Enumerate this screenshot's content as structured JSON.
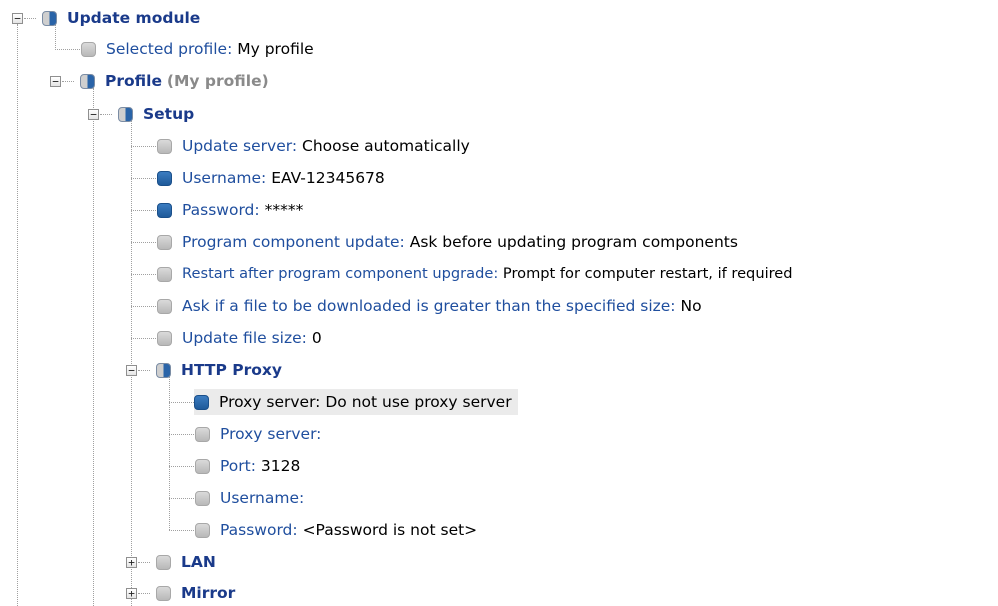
{
  "tree": {
    "update_module": {
      "label": "Update module"
    },
    "selected_profile": {
      "label": "Selected profile:",
      "value": "My profile"
    },
    "profile": {
      "label": "Profile",
      "value": "(My profile)"
    },
    "setup": {
      "label": "Setup"
    },
    "update_server": {
      "label": "Update server:",
      "value": "Choose automatically"
    },
    "username": {
      "label": "Username:",
      "value": "EAV-12345678"
    },
    "password": {
      "label": "Password:",
      "value": "*****"
    },
    "program_component_update": {
      "label": "Program component update:",
      "value": "Ask before updating program components"
    },
    "restart_after_upgrade": {
      "label": "Restart after program component upgrade:",
      "value": "Prompt for computer restart, if required"
    },
    "ask_file_size": {
      "label": "Ask if a file to be downloaded is greater than the specified size:",
      "value": "No"
    },
    "update_file_size": {
      "label": "Update file size:",
      "value": "0"
    },
    "http_proxy": {
      "label": "HTTP Proxy"
    },
    "proxy_server_mode": {
      "label": "Proxy server:",
      "value": "Do not use proxy server"
    },
    "proxy_server": {
      "label": "Proxy server:",
      "value": ""
    },
    "port": {
      "label": "Port:",
      "value": "3128"
    },
    "proxy_username": {
      "label": "Username:",
      "value": ""
    },
    "proxy_password": {
      "label": "Password:",
      "value": "<Password is not set>"
    },
    "lan": {
      "label": "LAN"
    },
    "mirror": {
      "label": "Mirror"
    }
  },
  "colors": {
    "label": "#1f4e9e",
    "bold_label": "#1a3a8a",
    "selection": "#ebebeb",
    "icon_blue": "#2a64a8",
    "icon_grey": "#c4c4c4"
  },
  "icons": {
    "expanded": "minus-toggle-icon",
    "collapsed": "plus-toggle-icon"
  }
}
